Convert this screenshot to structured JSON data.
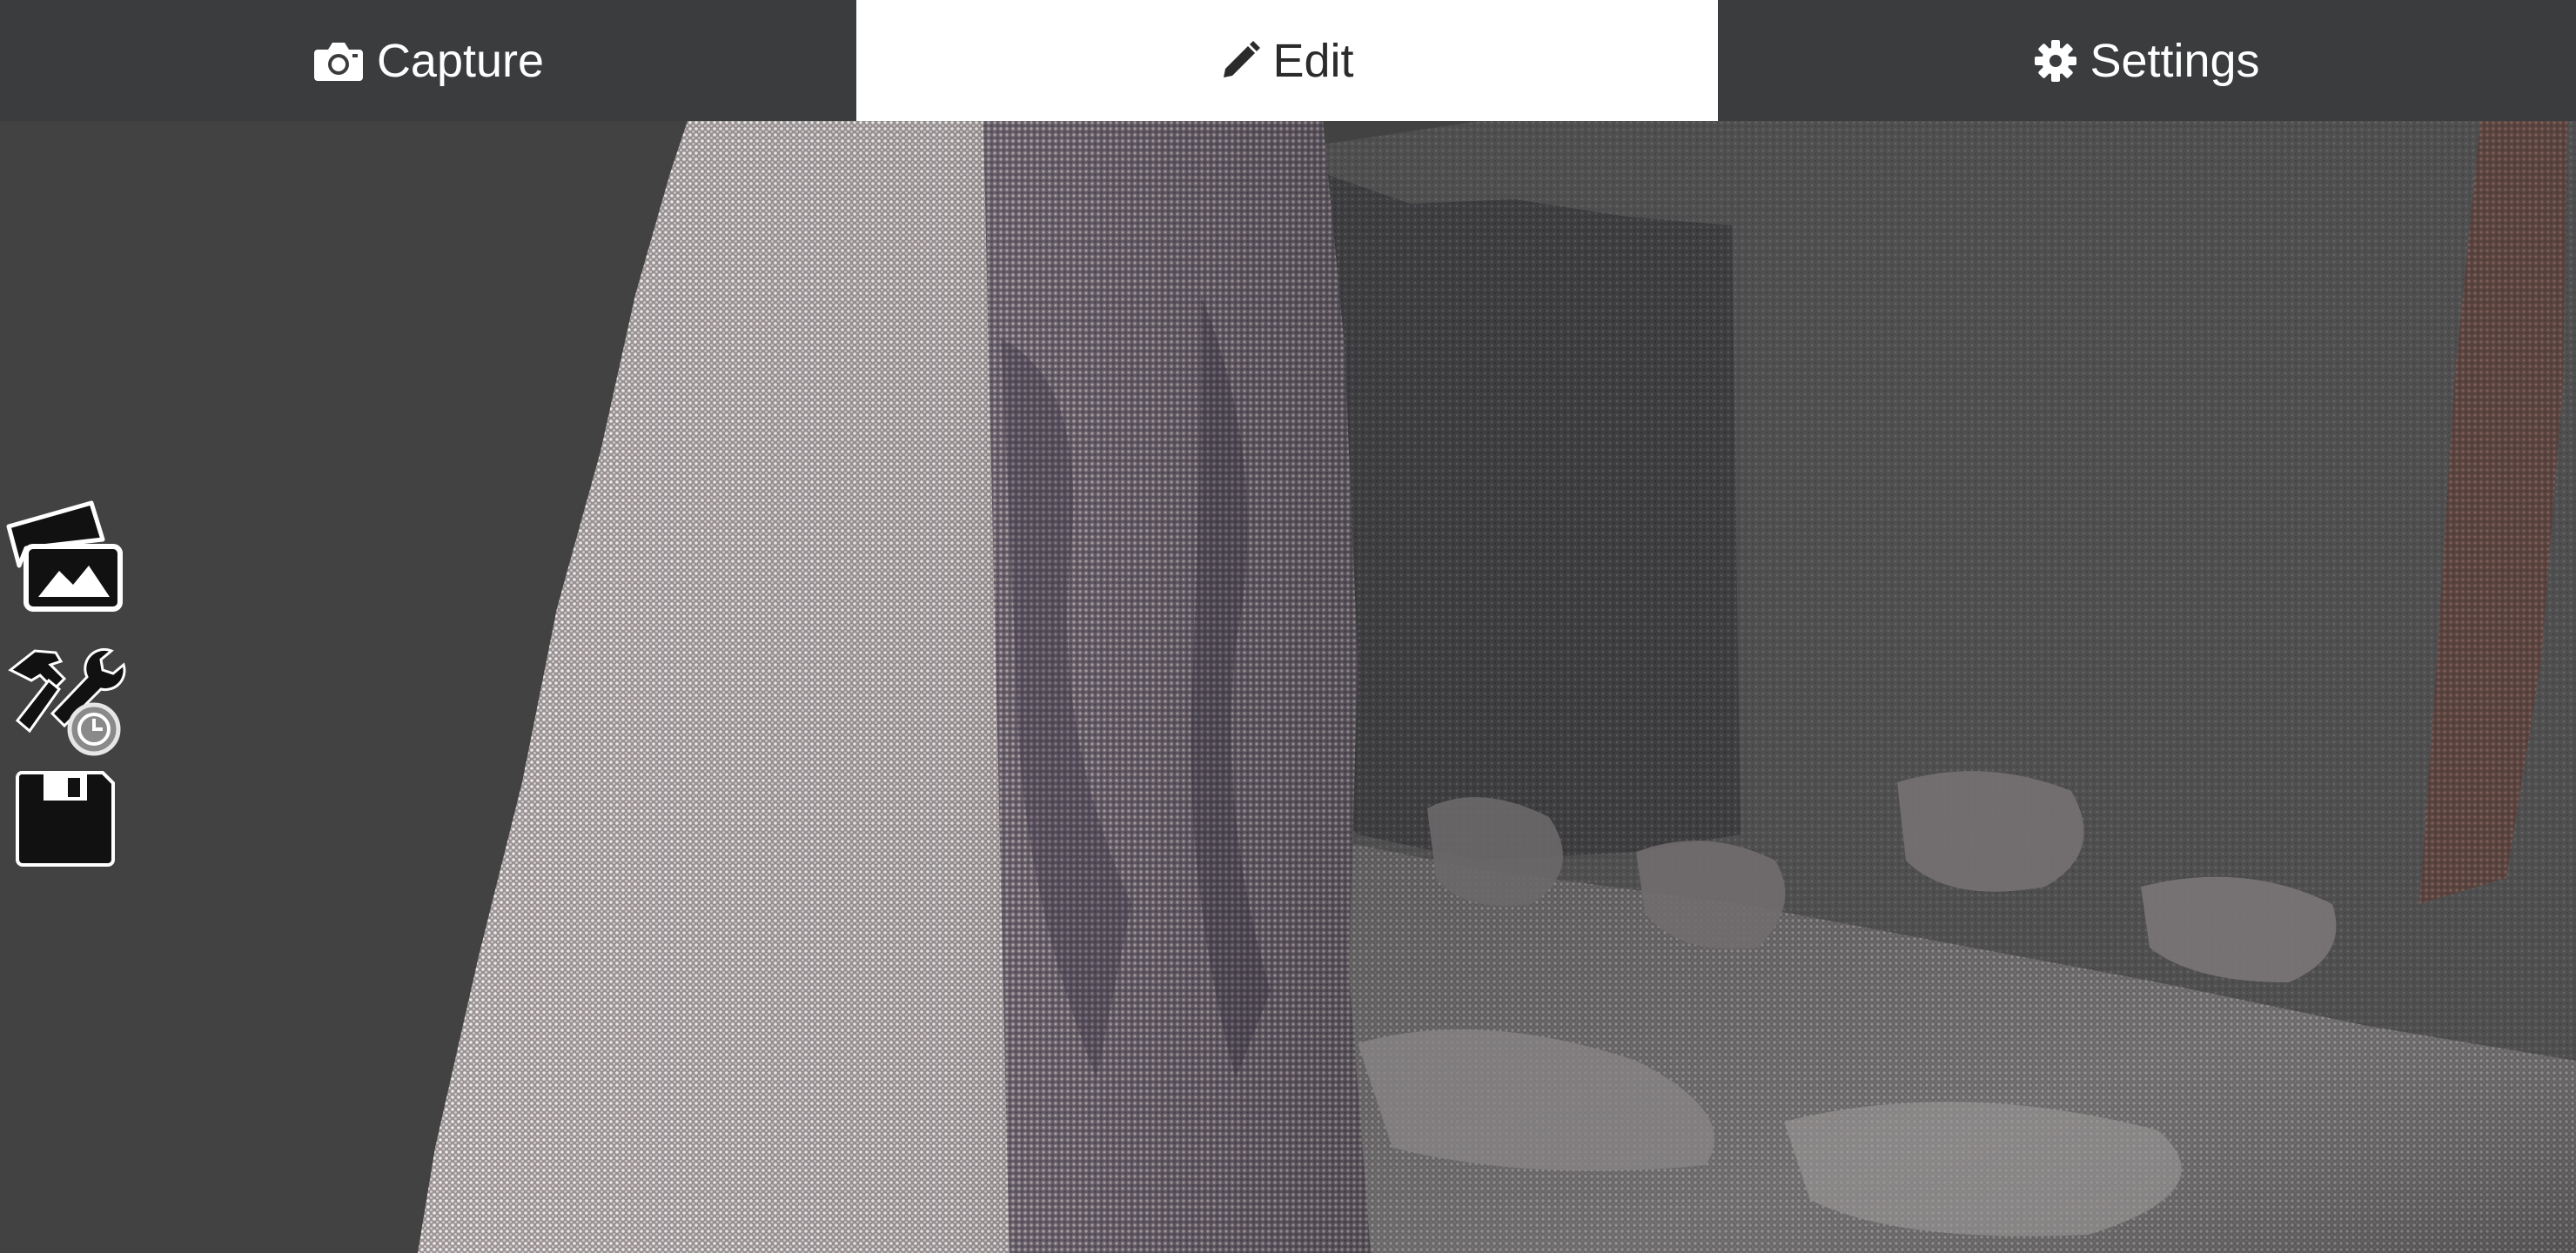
{
  "tabs": [
    {
      "label": "Capture",
      "icon": "camera-icon"
    },
    {
      "label": "Edit",
      "icon": "pencil-icon",
      "selected": true
    },
    {
      "label": "Settings",
      "icon": "gear-icon"
    }
  ],
  "toolbar": {
    "tools": [
      {
        "icon": "gallery-icon"
      },
      {
        "icon": "tools-icon"
      },
      {
        "icon": "save-icon"
      }
    ]
  },
  "colors": {
    "tab_bar_bg": "#3b3c3e",
    "tab_selected_bg": "#ffffff",
    "viewport_bg": "#424242"
  }
}
